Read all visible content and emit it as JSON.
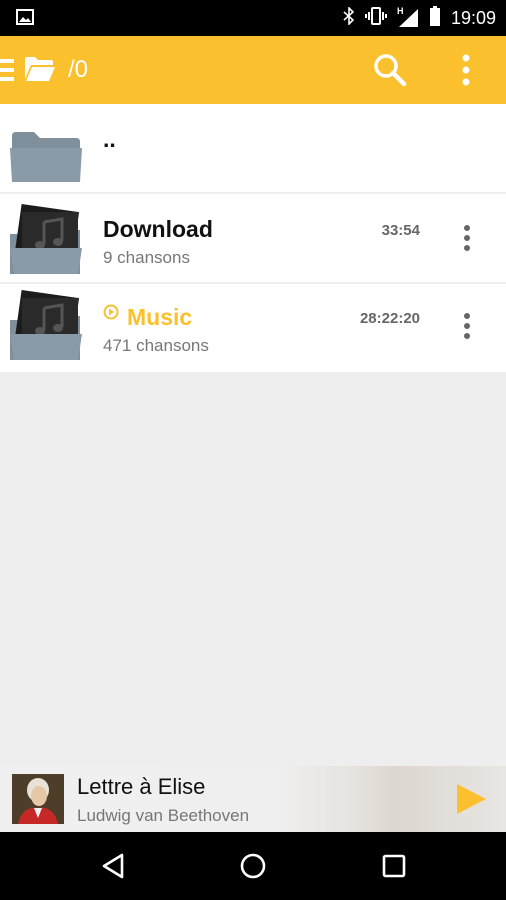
{
  "status_bar": {
    "time": "19:09",
    "network_label": "H"
  },
  "app_bar": {
    "path": "/0"
  },
  "list": {
    "parent": {
      "label": ".."
    },
    "items": [
      {
        "name": "Download",
        "count": "9 chansons",
        "duration": "33:54",
        "playing": false
      },
      {
        "name": "Music",
        "count": "471 chansons",
        "duration": "28:22:20",
        "playing": true
      }
    ]
  },
  "player": {
    "title": "Lettre à Elise",
    "artist": "Ludwig van Beethoven"
  },
  "colors": {
    "accent": "#fbc02d",
    "folder": "#8a9aa8",
    "background": "#eeeeee"
  }
}
